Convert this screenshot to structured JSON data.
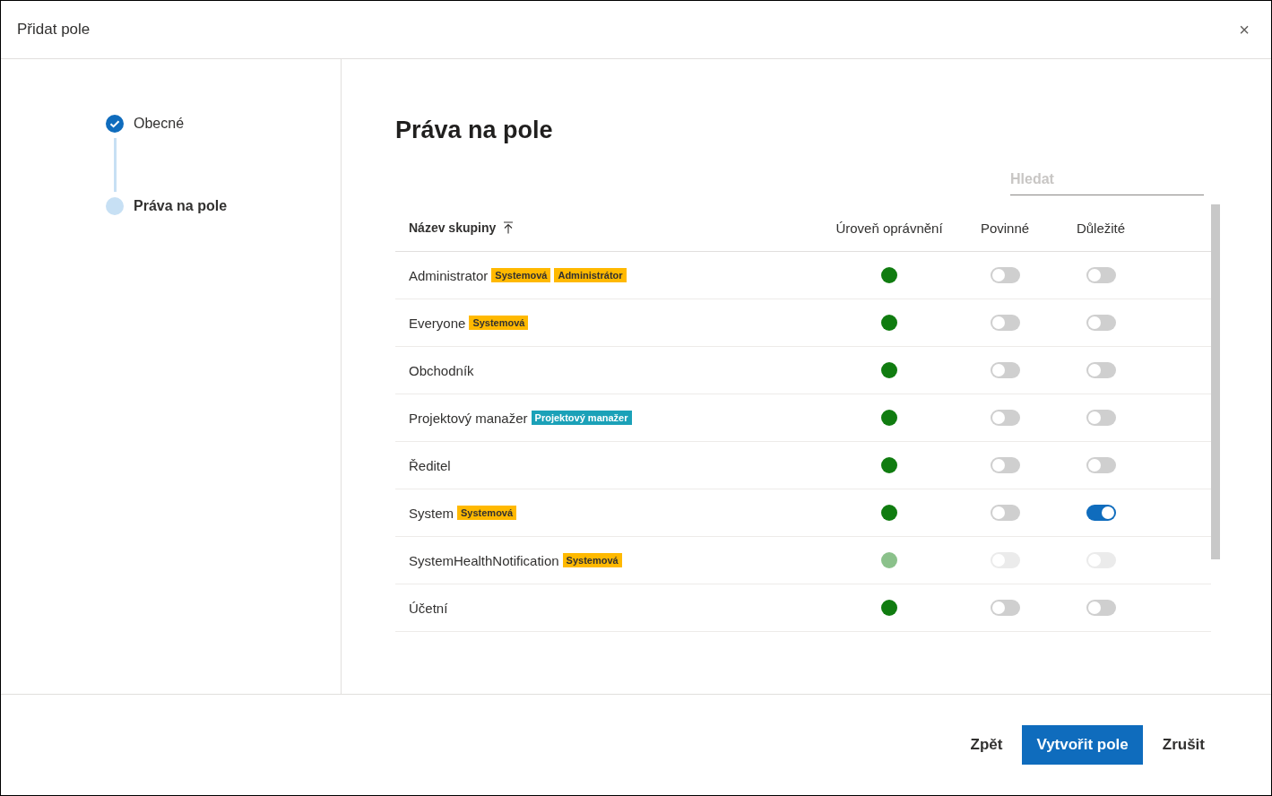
{
  "window": {
    "title": "Přidat pole",
    "close": "×"
  },
  "steps": [
    {
      "label": "Obecné",
      "completed": true
    },
    {
      "label": "Práva na pole",
      "completed": false
    }
  ],
  "heading": "Práva na pole",
  "search": {
    "placeholder": "Hledat"
  },
  "table": {
    "columns": [
      "Název skupiny",
      "Úroveň oprávnění",
      "Povinné",
      "Důležité"
    ],
    "rows": [
      {
        "name": "Administrator",
        "tags": [
          {
            "label": "Systemová",
            "color": "#ffb900"
          },
          {
            "label": "Administrátor",
            "color": "#ffb900"
          }
        ],
        "disabled": false,
        "required": false,
        "important": false
      },
      {
        "name": "Everyone",
        "tags": [
          {
            "label": "Systemová",
            "color": "#ffb900"
          }
        ],
        "disabled": false,
        "required": false,
        "important": false
      },
      {
        "name": "Obchodník",
        "tags": [],
        "disabled": false,
        "required": false,
        "important": false
      },
      {
        "name": "Projektový manažer",
        "tags": [
          {
            "label": "Projektový manažer",
            "color": "#1ba1b8"
          }
        ],
        "disabled": false,
        "required": false,
        "important": false
      },
      {
        "name": "Ředitel",
        "tags": [],
        "disabled": false,
        "required": false,
        "important": false
      },
      {
        "name": "System",
        "tags": [
          {
            "label": "Systemová",
            "color": "#ffb900"
          }
        ],
        "disabled": false,
        "required": false,
        "important": true
      },
      {
        "name": "SystemHealthNotification",
        "tags": [
          {
            "label": "Systemová",
            "color": "#ffb900"
          }
        ],
        "disabled": true,
        "required": false,
        "important": false
      },
      {
        "name": "Účetní",
        "tags": [],
        "disabled": false,
        "required": false,
        "important": false
      }
    ]
  },
  "buttons": [
    {
      "label": "Zpět",
      "kind": "text"
    },
    {
      "label": "Vytvořit pole",
      "kind": "primary"
    },
    {
      "label": "Zrušit",
      "kind": "text"
    }
  ]
}
